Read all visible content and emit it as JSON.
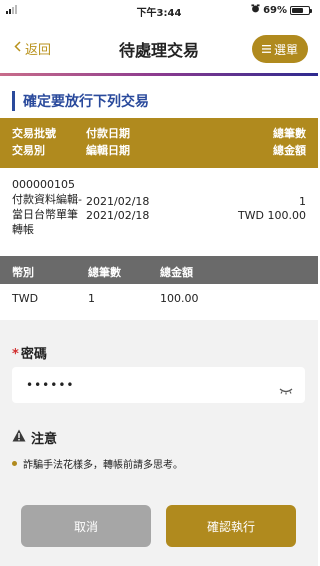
{
  "status_bar": {
    "time": "下午3:44",
    "battery_percent": "69%",
    "battery_level": 0.69
  },
  "nav": {
    "back_label": "返回",
    "title": "待處理交易",
    "menu_label": "選單"
  },
  "section": {
    "title": "確定要放行下列交易"
  },
  "txn_table": {
    "headers": {
      "col1": [
        "交易批號",
        "交易別"
      ],
      "col2": [
        "付款日期",
        "編輯日期"
      ],
      "col3": [
        "總筆數",
        "總金額"
      ]
    },
    "row": {
      "batch_no": "000000105",
      "type": "付款資料編輯-當日台幣單筆轉帳",
      "pay_date": "2021/02/18",
      "edit_date": "2021/02/18",
      "count": "1",
      "amount": "TWD 100.00"
    }
  },
  "currency_table": {
    "headers": [
      "幣別",
      "總筆數",
      "總金額"
    ],
    "row": [
      "TWD",
      "1",
      "100.00"
    ]
  },
  "password": {
    "label": "密碼",
    "required_mark": "*",
    "value": "••••••"
  },
  "notice": {
    "title": "注意",
    "items": [
      "詐騙手法花樣多，轉帳前請多思考。"
    ]
  },
  "buttons": {
    "cancel": "取消",
    "confirm": "確認執行"
  },
  "colors": {
    "gold": "#b08a1e",
    "blue": "#2a4a9c",
    "gray_header": "#6a6a6a",
    "cancel_gray": "#a6a6a6",
    "required_red": "#d12e2e"
  }
}
